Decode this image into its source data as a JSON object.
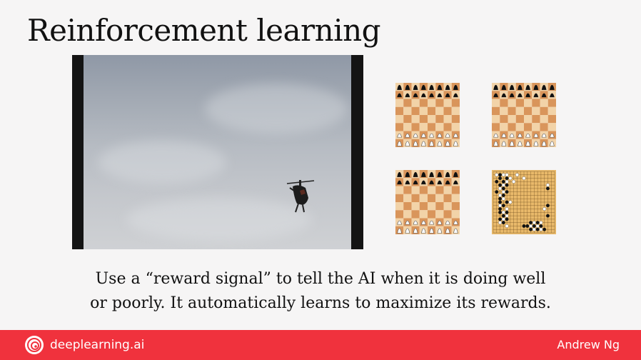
{
  "slide": {
    "title": "Reinforcement learning",
    "caption_line1": "Use a “reward signal” to tell the AI when it is doing well",
    "caption_line2": "or poorly. It automatically learns to maximize its rewards."
  },
  "video": {
    "subject": "helicopter-icon"
  },
  "boards": [
    {
      "kind": "chess"
    },
    {
      "kind": "chess"
    },
    {
      "kind": "chess"
    },
    {
      "kind": "go"
    }
  ],
  "footer": {
    "brand": "deeplearning.ai",
    "author": "Andrew Ng",
    "logo_icon": "deeplearning-logo-icon"
  },
  "colors": {
    "footer": "#f0323d",
    "board_light": "#f2d3a8",
    "board_dark": "#d9955b",
    "go_board": "#e9b96a"
  }
}
